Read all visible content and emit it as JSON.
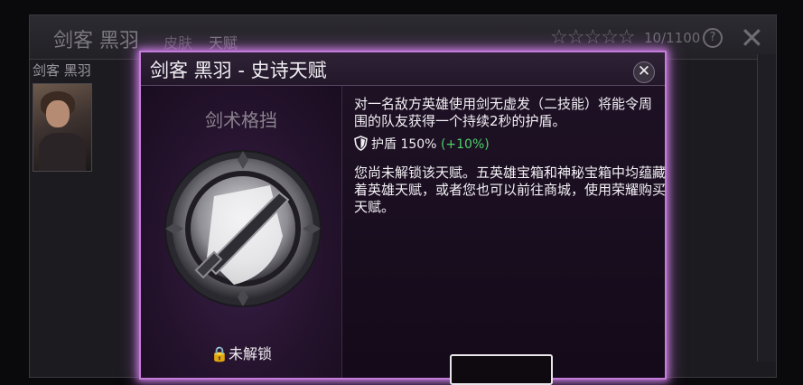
{
  "background": {
    "title": "剑客 黑羽",
    "tabs": [
      "皮肤",
      "天赋"
    ],
    "stars": "☆☆☆☆☆",
    "count": "10/1100",
    "help_label": "?",
    "close_label": "✕",
    "side_title": "剑客 黑羽"
  },
  "modal": {
    "title": "剑客 黑羽 - 史诗天赋",
    "close_label": "✕",
    "talent_name": "剑术格挡",
    "lock_status": "🔒未解锁",
    "description": "对一名敌方英雄使用剑无虚发（二技能）将能令周围的队友获得一个持续2秒的护盾。",
    "stat": {
      "label": "护盾 150%",
      "bonus": "(+10%)",
      "bonus_color": "#4cd36a",
      "icon": "shield-icon"
    },
    "unlock_hint": "您尚未解锁该天赋。五英雄宝箱和神秘宝箱中均蕴藏着英雄天赋，或者您也可以前往商城，使用荣耀购买天赋。"
  },
  "colors": {
    "modal_glow": "#c77bdc",
    "modal_bg": "#1f1226"
  }
}
